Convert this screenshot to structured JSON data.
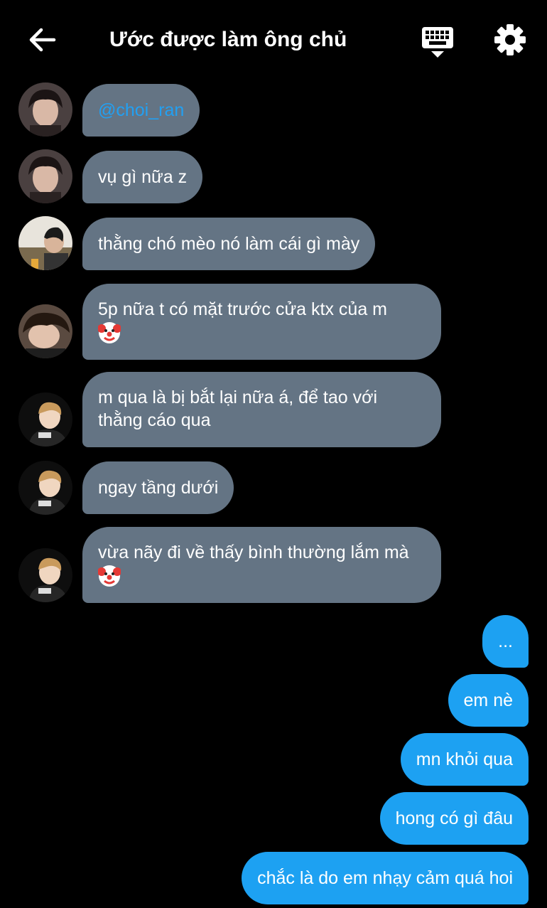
{
  "header": {
    "title": "Ước được làm ông chủ",
    "back_icon": "arrow-left-icon",
    "keyboard_icon": "keyboard-icon",
    "settings_icon": "gear-icon"
  },
  "colors": {
    "background": "#000000",
    "incoming_bubble": "#647484",
    "outgoing_bubble": "#1da1f2",
    "mention": "#22a0f2"
  },
  "messages_in": [
    {
      "text": "@choi_ran",
      "mention": true
    },
    {
      "text": "vụ gì nữa z"
    },
    {
      "text": "thằng chó mèo nó làm cái gì mày"
    },
    {
      "text": "5p nữa t có mặt trước cửa ktx của m",
      "emoji": "clown-face-emoji"
    },
    {
      "text": "m qua là bị bắt lại nữa á, để tao với thằng cáo qua"
    },
    {
      "text": "ngay tầng dưới"
    },
    {
      "text": "vừa nãy đi về thấy bình thường lắm mà",
      "emoji": "clown-face-emoji"
    }
  ],
  "messages_out": [
    {
      "text": "..."
    },
    {
      "text": "em nè"
    },
    {
      "text": "mn khỏi qua"
    },
    {
      "text": "hong có gì đâu"
    },
    {
      "text": "chắc là do em nhạy cảm quá hoi"
    }
  ]
}
